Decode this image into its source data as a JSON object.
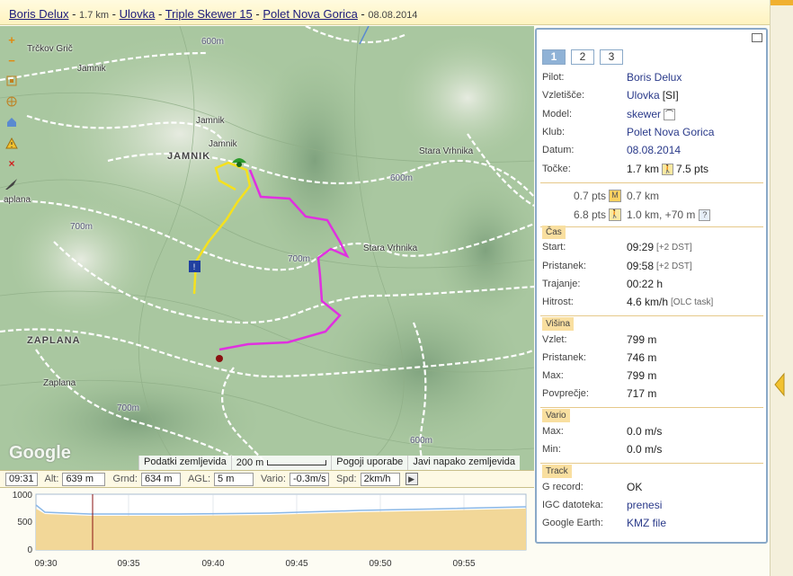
{
  "title": {
    "pilot": "Boris Delux",
    "sep1": " - ",
    "distance": "1.7 km",
    "sep2": " - ",
    "site": "Ulovka",
    "sep3": " - ",
    "glider": "Triple Skewer 15",
    "sep4": " - ",
    "club": "Polet Nova Gorica",
    "sep5": " - ",
    "date": "08.08.2014"
  },
  "map": {
    "labels": {
      "trckov": "Trčkov Grič",
      "jamnik1": "Jamnik",
      "jamnik2": "Jamnik",
      "jamnik3": "Jamnik",
      "jamnik_big": "JAMNIK",
      "stara_vrhnika1": "Stara Vrhnika",
      "stara_vrhnika2": "Stara Vrhnika",
      "zaplana1": "aplana",
      "zaplana_big": "ZAPLANA",
      "zaplana2": "Zaplana",
      "c600a": "600m",
      "c600b": "600m",
      "c700a": "700m",
      "c700b": "700m",
      "c700c": "700m",
      "c600c": "600m"
    },
    "google": "Google",
    "footer": {
      "data": "Podatki zemljevida",
      "scale": "200 m",
      "terms": "Pogoji uporabe",
      "report": "Javi napako zemljevida"
    },
    "tools": [
      "zoom-in-icon",
      "zoom-out-icon",
      "fit-icon",
      "layers-icon",
      "home-icon",
      "warning-icon",
      "close-icon",
      "plane-icon"
    ],
    "track_colors": {
      "takeoff_leg": "#f5e11e",
      "flight": "#e030e0"
    }
  },
  "status": {
    "time": "09:31",
    "alt_label": "Alt:",
    "alt": "639 m",
    "grnd_label": "Grnd:",
    "grnd": "634 m",
    "agl_label": "AGL:",
    "agl": "5 m",
    "vario_label": "Vario:",
    "vario": "-0.3m/s",
    "spd_label": "Spd:",
    "spd": "2km/h"
  },
  "graph": {
    "y_ticks": [
      "1000",
      "500",
      "0"
    ],
    "x_ticks": [
      "09:30",
      "09:35",
      "09:40",
      "09:45",
      "09:50",
      "09:55"
    ],
    "cursor_time": "09:31"
  },
  "panel": {
    "tabs": [
      "1",
      "2",
      "3"
    ],
    "pilot_label": "Pilot:",
    "pilot": "Boris Delux",
    "takeoff_label": "Vzletišče:",
    "takeoff": "Ulovka",
    "takeoff_country": "[SI]",
    "model_label": "Model:",
    "model": "skewer",
    "club_label": "Klub:",
    "club": "Polet Nova Gorica",
    "date_label": "Datum:",
    "date": "08.08.2014",
    "points_label": "Točke:",
    "points_dist": "1.7 km",
    "points_pts": "7.5 pts",
    "alt1_pts": "0.7 pts",
    "alt1_dist": "0.7 km",
    "alt2_pts": "6.8 pts",
    "alt2_dist": "1.0 km, +70 m",
    "help": "?",
    "time_section": "Čas",
    "start_label": "Start:",
    "start": "09:29",
    "start_dst": "[+2 DST]",
    "landing_label": "Pristanek:",
    "landing": "09:58",
    "landing_dst": "[+2 DST]",
    "duration_label": "Trajanje:",
    "duration": "00:22 h",
    "speed_label": "Hitrost:",
    "speed": "4.6 km/h",
    "speed_note": "[OLC task]",
    "height_section": "Višina",
    "h_takeoff_label": "Vzlet:",
    "h_takeoff": "799 m",
    "h_landing_label": "Pristanek:",
    "h_landing": "746 m",
    "h_max_label": "Max:",
    "h_max": "799 m",
    "h_avg_label": "Povprečje:",
    "h_avg": "717 m",
    "vario_section": "Vario",
    "v_max_label": "Max:",
    "v_max": "0.0 m/s",
    "v_min_label": "Min:",
    "v_min": "0.0 m/s",
    "track_section": "Track",
    "grecord_label": "G record:",
    "grecord": "OK",
    "igc_label": "IGC datoteka:",
    "igc": "prenesi",
    "ge_label": "Google Earth:",
    "ge": "KMZ file"
  },
  "colors": {
    "accent": "#8fb2d6",
    "section": "#f9dfa0",
    "link": "#2a3a8a"
  }
}
